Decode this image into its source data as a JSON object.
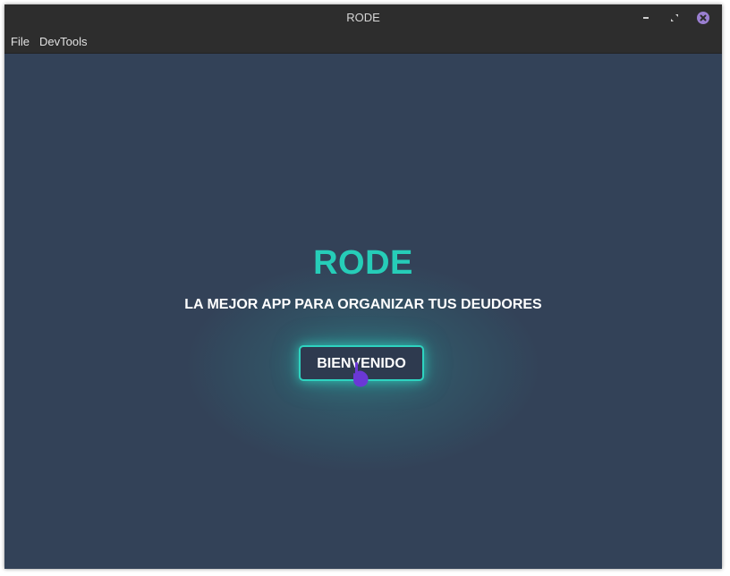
{
  "window": {
    "title": "RODE"
  },
  "menubar": {
    "items": [
      {
        "label": "File"
      },
      {
        "label": "DevTools"
      }
    ]
  },
  "hero": {
    "brand": "RODE",
    "tagline": "LA MEJOR APP PARA ORGANIZAR TUS DEUDORES",
    "button_label": "BIENVENIDO"
  },
  "icons": {
    "minimize": "minimize-icon",
    "maximize": "maximize-icon",
    "close": "close-icon",
    "cursor": "hand-pointer-cursor-icon"
  },
  "colors": {
    "background": "#334258",
    "accent": "#26cdb8",
    "titlebar": "#2d2d2d",
    "close_button": "#9a7fd1",
    "cursor": "#6a38d6"
  }
}
